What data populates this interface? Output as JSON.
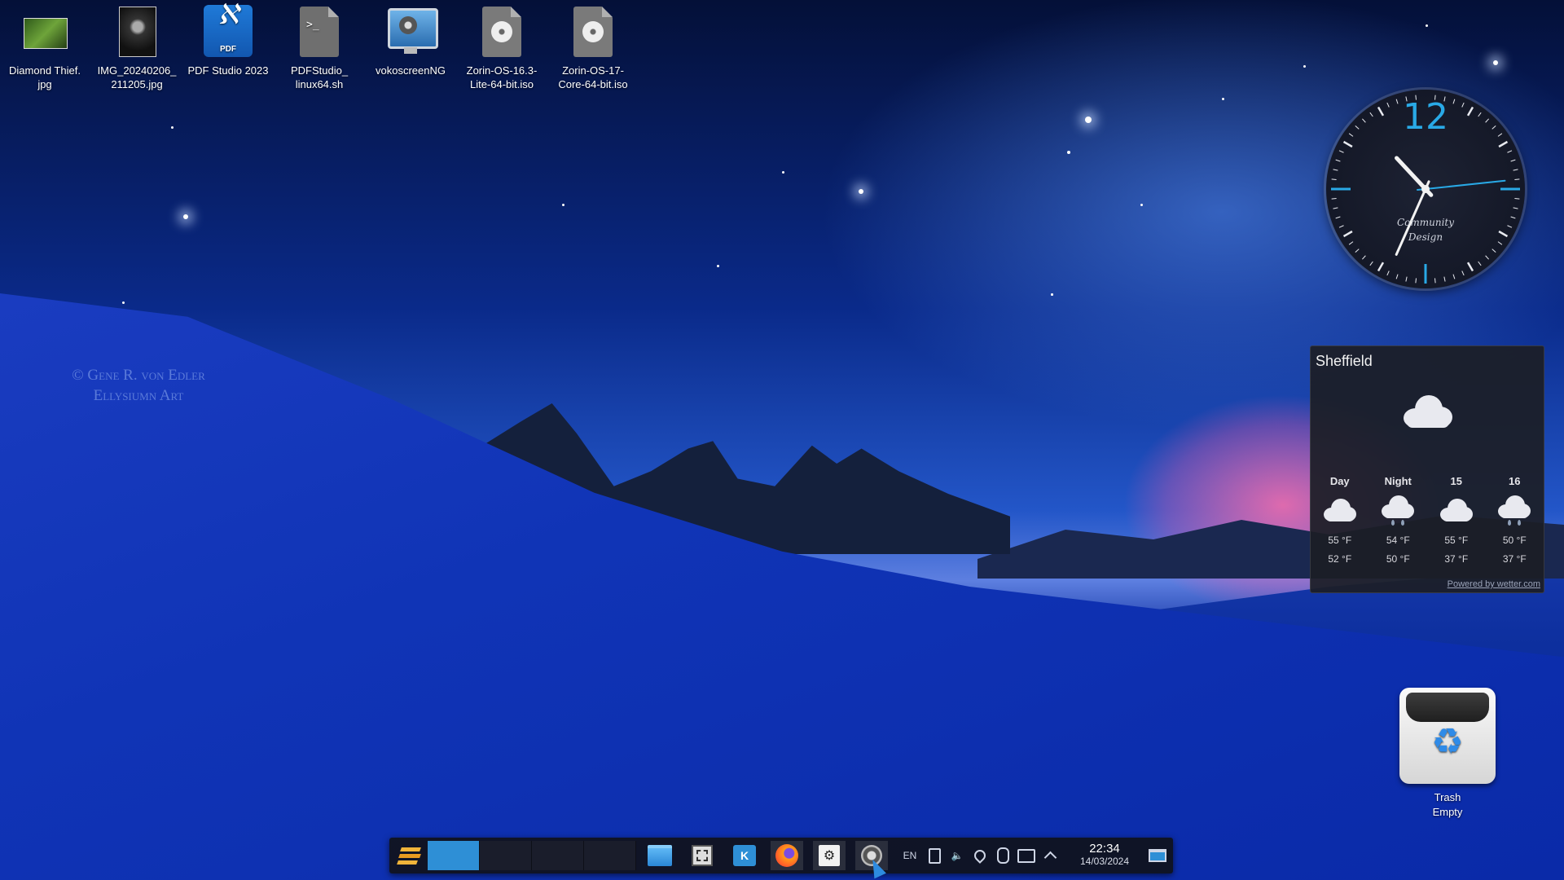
{
  "desktop": {
    "watermark_line1": "© Gene R. von Edler",
    "watermark_line2": "Ellysiumn Art",
    "icons": [
      {
        "line1": "Diamond Thief.",
        "line2": "jpg",
        "icon": "image-thumbnail-icon"
      },
      {
        "line1": "IMG_20240206_",
        "line2": "211205.jpg",
        "icon": "image-thumbnail-icon"
      },
      {
        "line1": "PDF Studio 2023",
        "line2": "",
        "icon": "pdf-studio-icon",
        "badge": "PDF"
      },
      {
        "line1": "PDFStudio_",
        "line2": "linux64.sh",
        "icon": "terminal-script-icon",
        "glyph_text": ">_"
      },
      {
        "line1": "vokoscreenNG",
        "line2": "",
        "icon": "screen-recorder-icon"
      },
      {
        "line1": "Zorin-OS-16.3-",
        "line2": "Lite-64-bit.iso",
        "icon": "disc-image-icon"
      },
      {
        "line1": "Zorin-OS-17-",
        "line2": "Core-64-bit.iso",
        "icon": "disc-image-icon"
      }
    ],
    "trash": {
      "label": "Trash",
      "status": "Empty"
    }
  },
  "clock_widget": {
    "numeral": "12",
    "brand_line1": "Community",
    "brand_line2": "Design",
    "accent_color": "#29a9e6"
  },
  "weather_widget": {
    "city": "Sheffield",
    "current_icon": "cloud-icon",
    "forecast": [
      {
        "label": "Day",
        "icon": "cloud-icon",
        "high": "55 °F",
        "low": "52 °F"
      },
      {
        "label": "Night",
        "icon": "cloud-rain-icon",
        "high": "54 °F",
        "low": "50 °F"
      },
      {
        "label": "15",
        "icon": "cloud-icon",
        "high": "55 °F",
        "low": "37 °F"
      },
      {
        "label": "16",
        "icon": "cloud-rain-icon",
        "high": "50 °F",
        "low": "37 °F"
      }
    ],
    "powered_by": "Powered by wetter.com"
  },
  "taskbar": {
    "language": "EN",
    "time": "22:34",
    "date": "14/03/2024",
    "apps": [
      "zorin-menu-icon",
      "file-manager-icon",
      "screenshot-tool-icon",
      "software-store-icon",
      "firefox-icon",
      "kde-settings-icon",
      "vokoscreen-icon"
    ],
    "tray": [
      "clipboard-icon",
      "volume-icon",
      "location-icon",
      "mouse-icon",
      "folder-icon",
      "chevron-up-icon"
    ],
    "accent_color": "#2e8fd6"
  }
}
